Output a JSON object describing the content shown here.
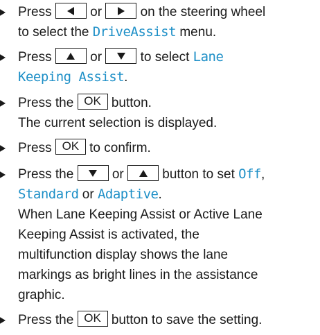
{
  "steps": [
    {
      "l1_a": "Press",
      "l1_b": "or",
      "l1_c": "on the steering wheel",
      "l2_a": "to select the",
      "menu": "DriveAssist",
      "l2_b": "menu."
    },
    {
      "l1_a": "Press",
      "l1_b": "or",
      "l1_c": "to select",
      "opt1": "Lane",
      "opt2": "Keeping Assist",
      "l2_end": "."
    },
    {
      "l1_a": "Press the",
      "ok": "OK",
      "l1_b": "button.",
      "l2": "The current selection is displayed."
    },
    {
      "l1_a": "Press",
      "ok": "OK",
      "l1_b": "to confirm."
    },
    {
      "l1_a": "Press the",
      "l1_b": "or",
      "l1_c": "button to set",
      "off": "Off",
      "comma": ",",
      "standard": "Standard",
      "or2": "or",
      "adaptive": "Adaptive",
      "dot": ".",
      "p1": "When Lane Keeping Assist or Active Lane",
      "p2": "Keeping Assist is activated, the",
      "p3": "multifunction display shows the lane",
      "p4": "markings as bright lines in the assistance",
      "p5": "graphic."
    },
    {
      "l1_a": "Press the",
      "ok": "OK",
      "l1_b": "button to save the setting."
    }
  ],
  "icons": {
    "left": "left-arrow-key",
    "right": "right-arrow-key",
    "up": "up-arrow-key",
    "down": "down-arrow-key"
  }
}
